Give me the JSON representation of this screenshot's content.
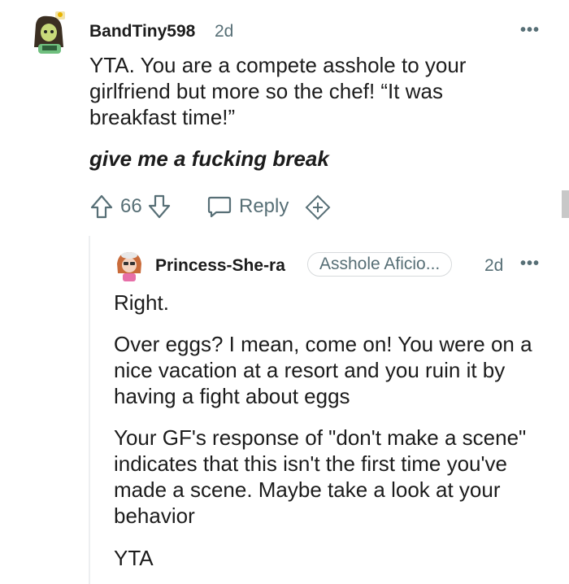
{
  "comment1": {
    "username": "BandTiny598",
    "age": "2d",
    "more": "•••",
    "paragraphs": [
      "YTA. You are a compete asshole to your girlfriend but more so the chef! “It was breakfast time!”",
      "give me a fucking break"
    ],
    "score": "66",
    "reply_label": "Reply"
  },
  "comment2": {
    "username": "Princess-She-ra",
    "flair": "Asshole Aficio...",
    "age": "2d",
    "more": "•••",
    "paragraphs": [
      "Right.",
      "Over eggs? I mean, come on! You were on a nice vacation at a resort and you ruin it by having a fight about eggs",
      "Your GF's response of \"don't make a scene\" indicates that this isn't the first time you've made a scene. Maybe take a look at your behavior",
      "YTA"
    ]
  },
  "colors": {
    "text": "#1c1c1c",
    "meta": "#576f76",
    "thread_line": "#edeff1"
  }
}
